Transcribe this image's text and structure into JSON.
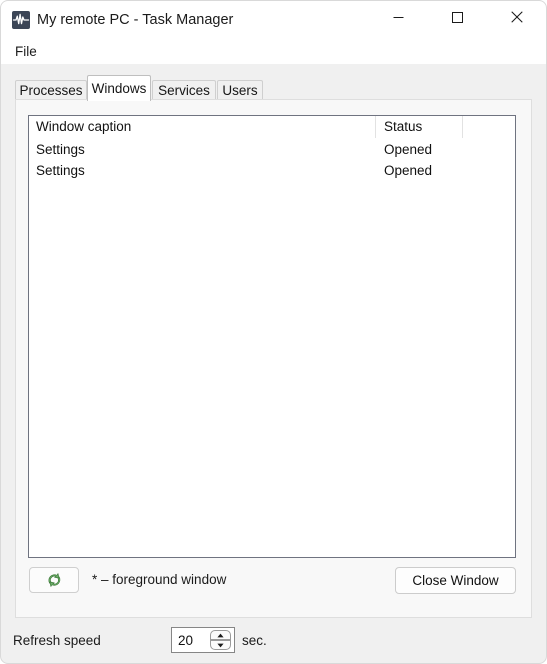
{
  "window": {
    "title": "My remote PC - Task Manager",
    "app_icon": "taskmanager-pulse-icon",
    "controls": {
      "minimize": "minimize-icon",
      "maximize": "maximize-icon",
      "close": "close-icon"
    }
  },
  "menubar": {
    "items": [
      {
        "label": "File"
      }
    ]
  },
  "tabs": [
    {
      "label": "Processes",
      "selected": false
    },
    {
      "label": "Windows",
      "selected": true
    },
    {
      "label": "Services",
      "selected": false
    },
    {
      "label": "Users",
      "selected": false
    }
  ],
  "list": {
    "columns": [
      {
        "label": "Window caption"
      },
      {
        "label": "Status"
      },
      {
        "label": ""
      }
    ],
    "rows": [
      {
        "caption": "Settings",
        "status": "Opened"
      },
      {
        "caption": "Settings",
        "status": "Opened"
      }
    ]
  },
  "footer": {
    "refresh_button_icon": "refresh-arrows-icon",
    "legend": "* – foreground window",
    "close_window_label": "Close Window"
  },
  "refresh_speed": {
    "label": "Refresh speed",
    "value": "20",
    "unit": "sec.",
    "spin_up_icon": "triangle-up-icon",
    "spin_down_icon": "triangle-down-icon"
  },
  "colors": {
    "window_bg": "#f0f0f0",
    "titlebar_bg": "#ffffff",
    "panel_bg": "#f8f8f8",
    "list_bg": "#ffffff",
    "list_border": "#6f7380",
    "text": "#111111",
    "refresh_icon_green": "#5aa357"
  }
}
